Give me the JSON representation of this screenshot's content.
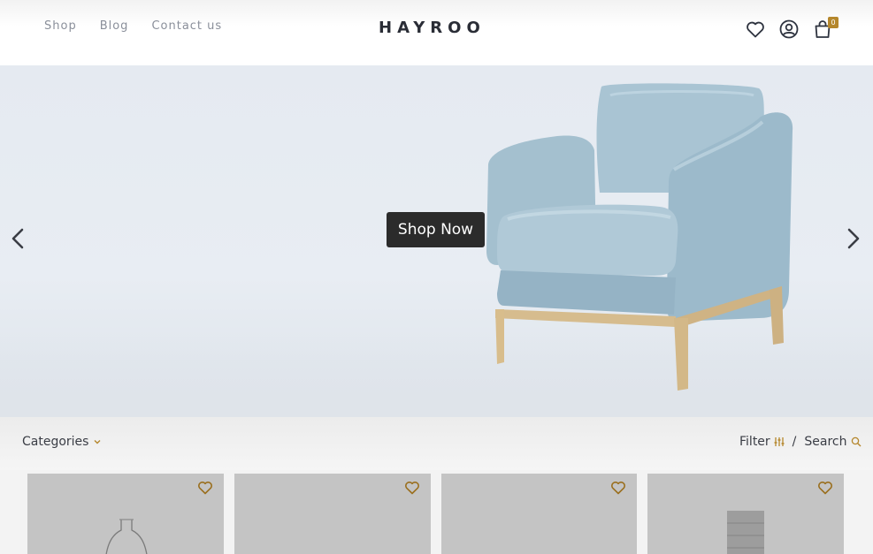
{
  "header": {
    "nav": [
      "Shop",
      "Blog",
      "Contact us"
    ],
    "logo": "HAYROO",
    "cart_count": "0",
    "icons": [
      "heart-icon",
      "user-icon",
      "cart-icon"
    ]
  },
  "hero": {
    "cta_label": "Shop Now",
    "image": "light-blue-armchair"
  },
  "toolbar": {
    "categories_label": "Categories",
    "filter_label": "Filter",
    "separator": "/",
    "search_label": "Search"
  },
  "products": [
    {
      "image": "glass-vase"
    },
    {
      "image": "blank"
    },
    {
      "image": "blank"
    },
    {
      "image": "grey-drawers"
    }
  ],
  "colors": {
    "accent": "#b5872c",
    "dark": "#2b2b2b",
    "card_bg": "#c4c4c4"
  }
}
